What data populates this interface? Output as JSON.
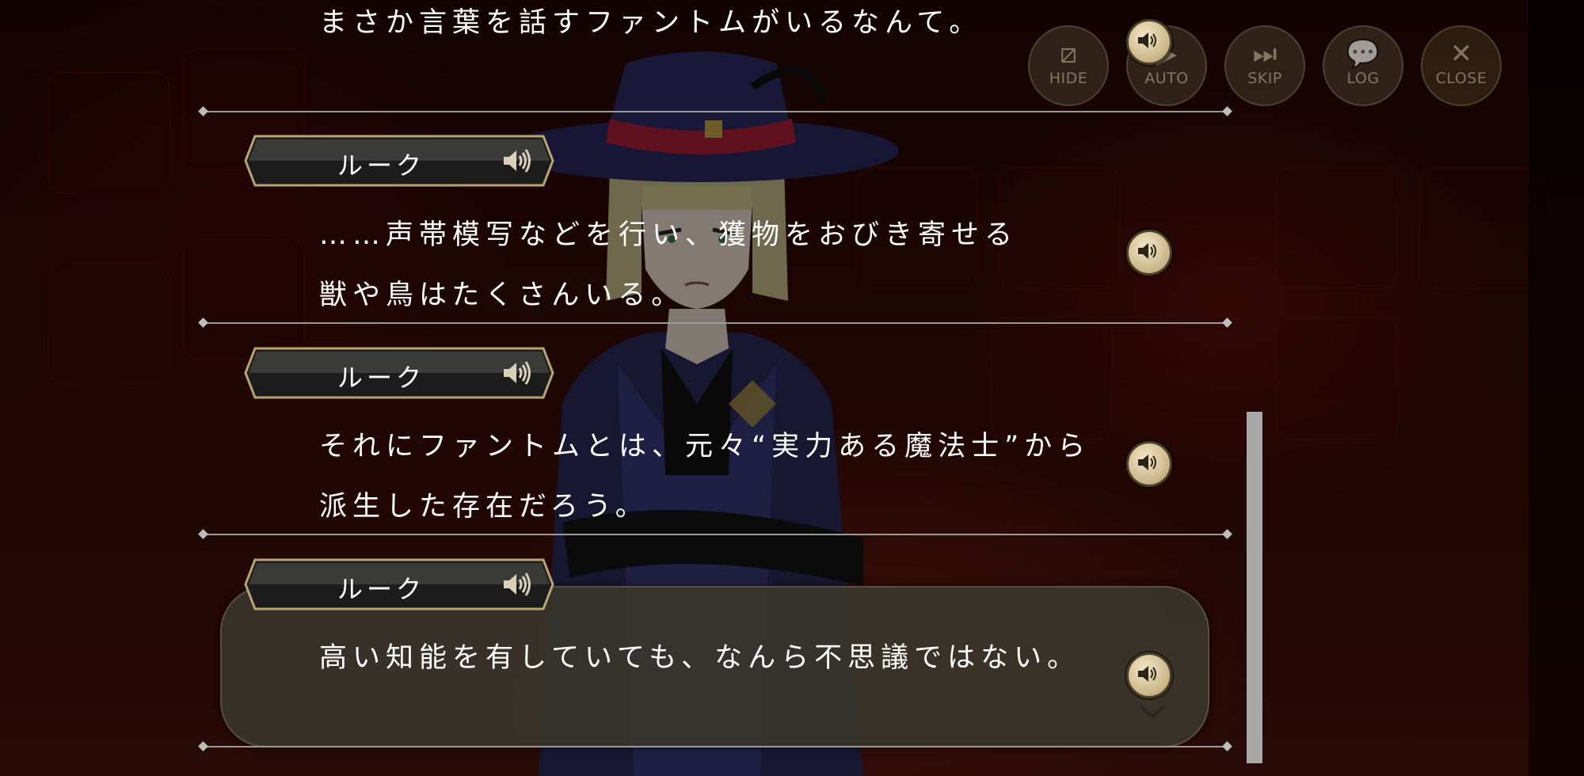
{
  "toolbar": {
    "hide_label": "HIDE",
    "auto_label": "AUTO",
    "skip_label": "SKIP",
    "log_label": "LOG",
    "close_label": "CLOSE"
  },
  "log": {
    "entries": [
      {
        "speaker": "",
        "lines": [
          "まさか言葉を話すファントムがいるなんて。"
        ]
      },
      {
        "speaker": "ルーク",
        "lines": [
          "……声帯模写などを行い、獲物をおびき寄せる",
          "獣や鳥はたくさんいる。"
        ]
      },
      {
        "speaker": "ルーク",
        "lines": [
          "それにファントムとは、元々“実力ある魔法士”から",
          "派生した存在だろう。"
        ]
      },
      {
        "speaker": "ルーク",
        "lines": [
          "高い知能を有していても、なんら不思議ではない。"
        ]
      }
    ]
  },
  "colors": {
    "accent_gold": "#c9b487",
    "text": "#ffffff",
    "panel": "#3a362e"
  }
}
